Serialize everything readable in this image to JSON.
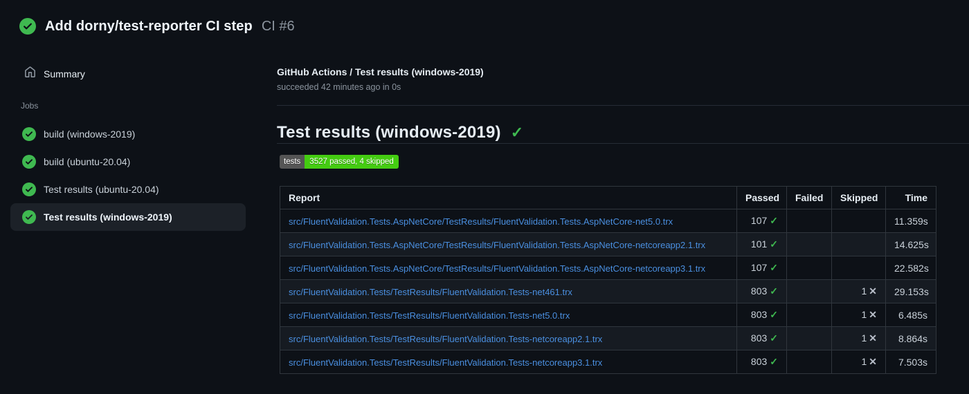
{
  "header": {
    "title": "Add dorny/test-reporter CI step",
    "run_number": "CI #6",
    "status_icon": "check-circle-fill-icon"
  },
  "sidebar": {
    "summary_label": "Summary",
    "jobs_label": "Jobs",
    "jobs": [
      {
        "label": "build (windows-2019)",
        "status": "success",
        "selected": false
      },
      {
        "label": "build (ubuntu-20.04)",
        "status": "success",
        "selected": false
      },
      {
        "label": "Test results (ubuntu-20.04)",
        "status": "success",
        "selected": false
      },
      {
        "label": "Test results (windows-2019)",
        "status": "success",
        "selected": true
      }
    ]
  },
  "main": {
    "job_title": "GitHub Actions / Test results (windows-2019)",
    "job_subtitle": "succeeded 42 minutes ago in 0s",
    "heading": "Test results (windows-2019)",
    "heading_check": "✓",
    "badge": {
      "label": "tests",
      "value": "3527 passed, 4 skipped"
    },
    "table": {
      "columns": {
        "report": "Report",
        "passed": "Passed",
        "failed": "Failed",
        "skipped": "Skipped",
        "time": "Time"
      },
      "rows": [
        {
          "report": "src/FluentValidation.Tests.AspNetCore/TestResults/FluentValidation.Tests.AspNetCore-net5.0.trx",
          "passed": "107",
          "failed": "",
          "skipped": "",
          "time": "11.359s"
        },
        {
          "report": "src/FluentValidation.Tests.AspNetCore/TestResults/FluentValidation.Tests.AspNetCore-netcoreapp2.1.trx",
          "passed": "101",
          "failed": "",
          "skipped": "",
          "time": "14.625s"
        },
        {
          "report": "src/FluentValidation.Tests.AspNetCore/TestResults/FluentValidation.Tests.AspNetCore-netcoreapp3.1.trx",
          "passed": "107",
          "failed": "",
          "skipped": "",
          "time": "22.582s"
        },
        {
          "report": "src/FluentValidation.Tests/TestResults/FluentValidation.Tests-net461.trx",
          "passed": "803",
          "failed": "",
          "skipped": "1",
          "time": "29.153s"
        },
        {
          "report": "src/FluentValidation.Tests/TestResults/FluentValidation.Tests-net5.0.trx",
          "passed": "803",
          "failed": "",
          "skipped": "1",
          "time": "6.485s"
        },
        {
          "report": "src/FluentValidation.Tests/TestResults/FluentValidation.Tests-netcoreapp2.1.trx",
          "passed": "803",
          "failed": "",
          "skipped": "1",
          "time": "8.864s"
        },
        {
          "report": "src/FluentValidation.Tests/TestResults/FluentValidation.Tests-netcoreapp3.1.trx",
          "passed": "803",
          "failed": "",
          "skipped": "1",
          "time": "7.503s"
        }
      ],
      "passed_icon": "✓",
      "skipped_icon": "✕"
    }
  },
  "colors": {
    "page_bg": "#0d1117",
    "success_green": "#3fb950",
    "badge_label_bg": "#555555",
    "badge_value_bg": "#44cc11",
    "link_blue": "#4a8fe0",
    "muted_text": "#8b949e",
    "table_border": "#30363d",
    "selected_job_bg": "#1c2128"
  }
}
